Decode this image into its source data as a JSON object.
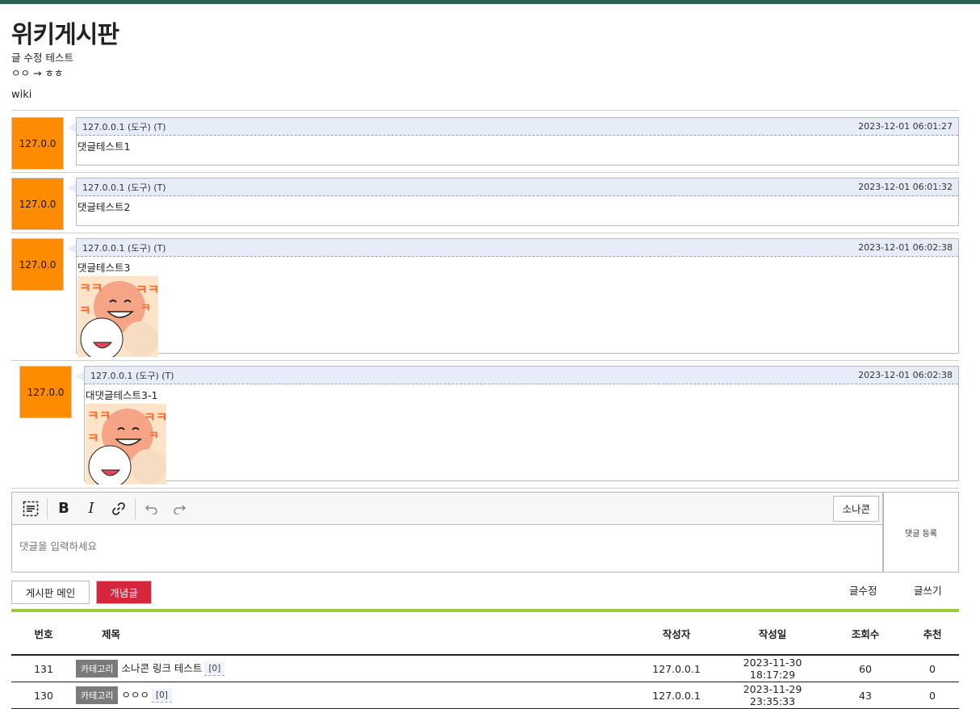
{
  "board": {
    "title": "위키게시판"
  },
  "post": {
    "subtitle": "글 수정 테스트",
    "change": "ㅇㅇ → ㅎㅎ",
    "body": "wiki"
  },
  "comments": [
    {
      "avatar": "127.0.0",
      "author": "127.0.0.1 (도구) (T)",
      "date": "2023-12-01 06:01:27",
      "text": "댓글테스트1",
      "has_emoticon": false
    },
    {
      "avatar": "127.0.0",
      "author": "127.0.0.1 (도구) (T)",
      "date": "2023-12-01 06:01:32",
      "text": "댓글테스트2",
      "has_emoticon": false
    },
    {
      "avatar": "127.0.0",
      "author": "127.0.0.1 (도구) (T)",
      "date": "2023-12-01 06:02:38",
      "text": "댓글테스트3",
      "has_emoticon": true
    },
    {
      "avatar": "127.0.0",
      "author": "127.0.0.1 (도구) (T)",
      "date": "2023-12-01 06:02:38",
      "text": "대댓글테스트3-1",
      "has_emoticon": true,
      "reply": true
    }
  ],
  "editor": {
    "toolbar": {
      "source_icon": "source-mode-icon",
      "bold_icon": "bold-icon",
      "italic_icon": "italic-icon",
      "link_icon": "link-icon",
      "undo_icon": "undo-icon",
      "redo_icon": "redo-icon"
    },
    "sonacon_label": "소나콘",
    "placeholder": "댓글을 입력하세요",
    "submit_label": "댓글 등록"
  },
  "actions": {
    "main_label": "게시판 메인",
    "concept_label": "개념글",
    "edit_label": "글수정",
    "write_label": "글쓰기"
  },
  "table": {
    "headers": {
      "no": "번호",
      "title": "제목",
      "writer": "작성자",
      "date": "작성일",
      "views": "조회수",
      "rec": "추천"
    },
    "rows": [
      {
        "no": "131",
        "category": "카테고리",
        "title": "소나콘 링크 테스트",
        "count": "[0]",
        "writer": "127.0.0.1",
        "date": "2023-11-30 18:17:29",
        "views": "60",
        "rec": "0"
      },
      {
        "no": "130",
        "category": "카테고리",
        "title": "ㅇㅇㅇ",
        "count": "[0]",
        "writer": "127.0.0.1",
        "date": "2023-11-29 23:35:33",
        "views": "43",
        "rec": "0"
      }
    ]
  },
  "colors": {
    "topbar": "#2b6150",
    "avatar": "#ff8c00",
    "concept": "#d6263d",
    "accent_line": "#9bcd3b"
  }
}
